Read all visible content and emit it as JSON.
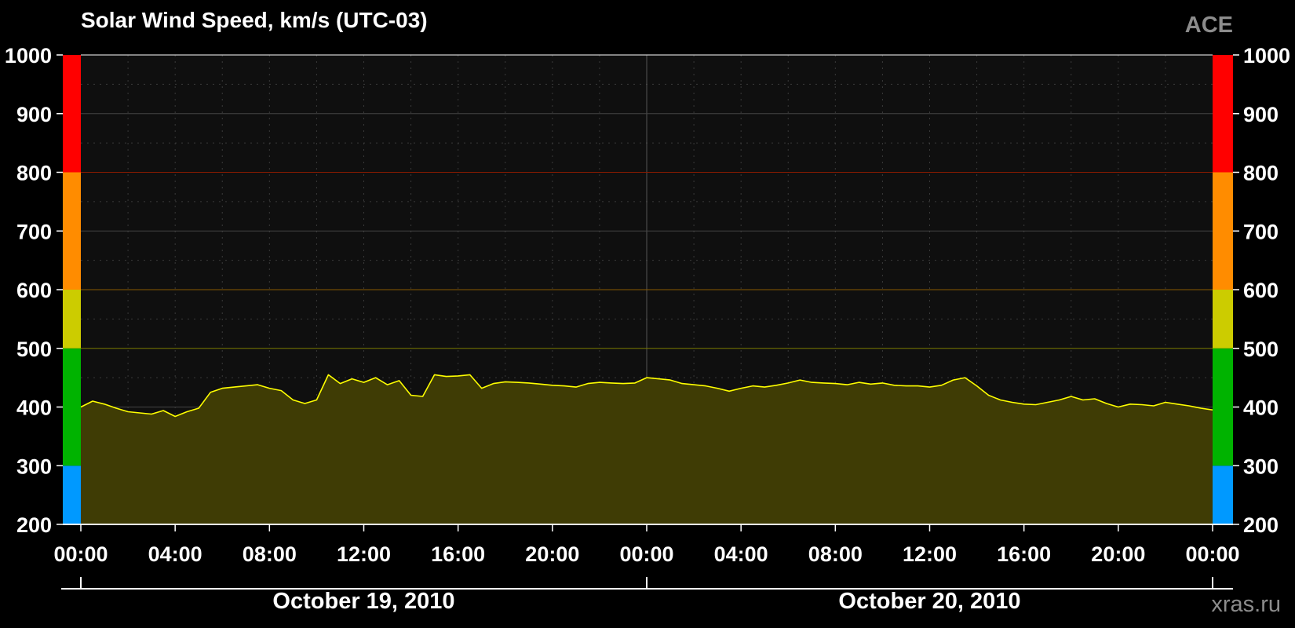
{
  "header": {
    "title": "Solar Wind Speed, km/s (UTC-03)",
    "source": "ACE",
    "credit": "xras.ru"
  },
  "chart_data": {
    "type": "area",
    "title": "Solar Wind Speed, km/s (UTC-03)",
    "xlabel": "",
    "ylabel": "",
    "ylim": [
      200,
      1000
    ],
    "yticks": [
      200,
      300,
      400,
      500,
      600,
      700,
      800,
      900,
      1000
    ],
    "xlim_hours": [
      0,
      48
    ],
    "xticks_hours": [
      0,
      4,
      8,
      12,
      16,
      20,
      24,
      28,
      32,
      36,
      40,
      44,
      48
    ],
    "xtick_labels": [
      "00:00",
      "04:00",
      "08:00",
      "12:00",
      "16:00",
      "20:00",
      "00:00",
      "04:00",
      "08:00",
      "12:00",
      "16:00",
      "20:00",
      "00:00"
    ],
    "dates": [
      {
        "label": "October 19, 2010",
        "start_hour": 0,
        "end_hour": 24
      },
      {
        "label": "October 20, 2010",
        "start_hour": 24,
        "end_hour": 48
      }
    ],
    "grid": true,
    "colors": {
      "line": "#ffff00",
      "fill": "#3f3c05",
      "plot_bg": "#0f0f0f",
      "page_bg": "#000000"
    },
    "levels": [
      {
        "from": 200,
        "to": 300,
        "color": "#0099ff"
      },
      {
        "from": 300,
        "to": 500,
        "color": "#00b300"
      },
      {
        "from": 500,
        "to": 600,
        "color": "#cccc00"
      },
      {
        "from": 600,
        "to": 800,
        "color": "#ff8c00"
      },
      {
        "from": 800,
        "to": 1000,
        "color": "#ff0000"
      }
    ],
    "threshold_lines": [
      {
        "value": 500,
        "color": "#7a7a00"
      },
      {
        "value": 600,
        "color": "#8a5a00"
      },
      {
        "value": 800,
        "color": "#8a1a00"
      }
    ],
    "series": [
      {
        "x_hours": [
          0,
          0.5,
          1,
          1.5,
          2,
          2.5,
          3,
          3.5,
          4,
          4.5,
          5,
          5.5,
          6,
          6.5,
          7,
          7.5,
          8,
          8.5,
          9,
          9.5,
          10,
          10.5,
          11,
          11.5,
          12,
          12.5,
          13,
          13.5,
          14,
          14.5,
          15,
          15.5,
          16,
          16.5,
          17,
          17.5,
          18,
          18.5,
          19,
          19.5,
          20,
          20.5,
          21,
          21.5,
          22,
          22.5,
          23,
          23.5,
          24,
          24.5,
          25,
          25.5,
          26,
          26.5,
          27,
          27.5,
          28,
          28.5,
          29,
          29.5,
          30,
          30.5,
          31,
          31.5,
          32,
          32.5,
          33,
          33.5,
          34,
          34.5,
          35,
          35.5,
          36,
          36.5,
          37,
          37.5,
          38,
          38.5,
          39,
          39.5,
          40,
          40.5,
          41,
          41.5,
          42,
          42.5,
          43,
          43.5,
          44,
          44.5,
          45,
          45.5,
          46,
          46.5,
          47,
          47.5,
          48
        ],
        "values": [
          400,
          410,
          405,
          398,
          392,
          390,
          388,
          394,
          384,
          392,
          398,
          425,
          432,
          434,
          436,
          438,
          432,
          428,
          412,
          406,
          412,
          455,
          440,
          448,
          442,
          450,
          438,
          445,
          420,
          418,
          455,
          452,
          453,
          455,
          432,
          440,
          443,
          442,
          441,
          439,
          437,
          436,
          434,
          440,
          442,
          441,
          440,
          441,
          450,
          448,
          446,
          440,
          438,
          436,
          432,
          427,
          432,
          436,
          434,
          437,
          441,
          446,
          442,
          441,
          440,
          438,
          442,
          439,
          441,
          437,
          436,
          436,
          434,
          437,
          446,
          450,
          436,
          420,
          412,
          408,
          405,
          404,
          408,
          412,
          418,
          412,
          414,
          406,
          400,
          405,
          404,
          402,
          408,
          405,
          402,
          398,
          395
        ]
      }
    ]
  }
}
